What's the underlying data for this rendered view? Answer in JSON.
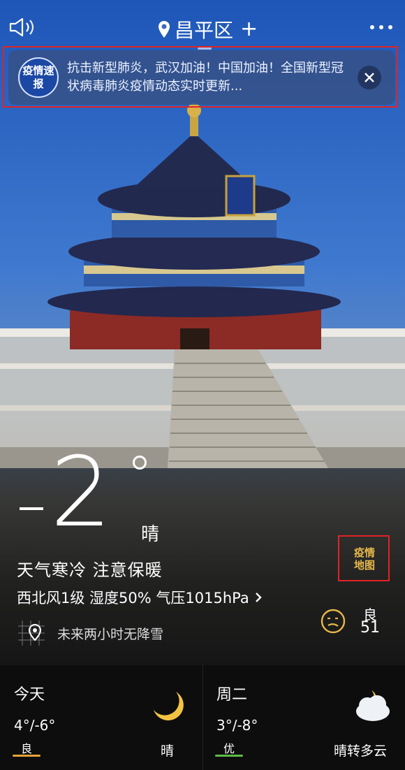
{
  "header": {
    "location": "昌平区",
    "add_symbol": "+",
    "icons": {
      "left": "speaker-icon",
      "right": "more-icon",
      "location": "pin-icon"
    }
  },
  "banner": {
    "badge": "疫情速报",
    "text": "抗击新型肺炎，武汉加油！中国加油！全国新型冠状病毒肺炎疫情动态实时更新...",
    "close_icon": "close-icon"
  },
  "current": {
    "temperature": "-2",
    "condition": "晴",
    "tip": "天气寒冷 注意保暖",
    "details": "西北风1级 湿度50% 气压1015hPa",
    "precip_text": "未来两小时无降雪"
  },
  "epidemic_map": {
    "label": "疫情地图"
  },
  "aqi": {
    "level": "良",
    "value": "51",
    "color": "#e6b84a"
  },
  "forecast": [
    {
      "day": "今天",
      "range": "4°/-6°",
      "aqi": "良",
      "aqi_color": "#e8a23a",
      "condition": "晴",
      "icon": "moon-icon"
    },
    {
      "day": "周二",
      "range": "3°/-8°",
      "aqi": "优",
      "aqi_color": "#5cbd4a",
      "condition": "晴转多云",
      "icon": "cloud-moon-icon"
    }
  ],
  "colors": {
    "highlight_outline": "#e02424",
    "banner_badge": "#1c48a5"
  }
}
